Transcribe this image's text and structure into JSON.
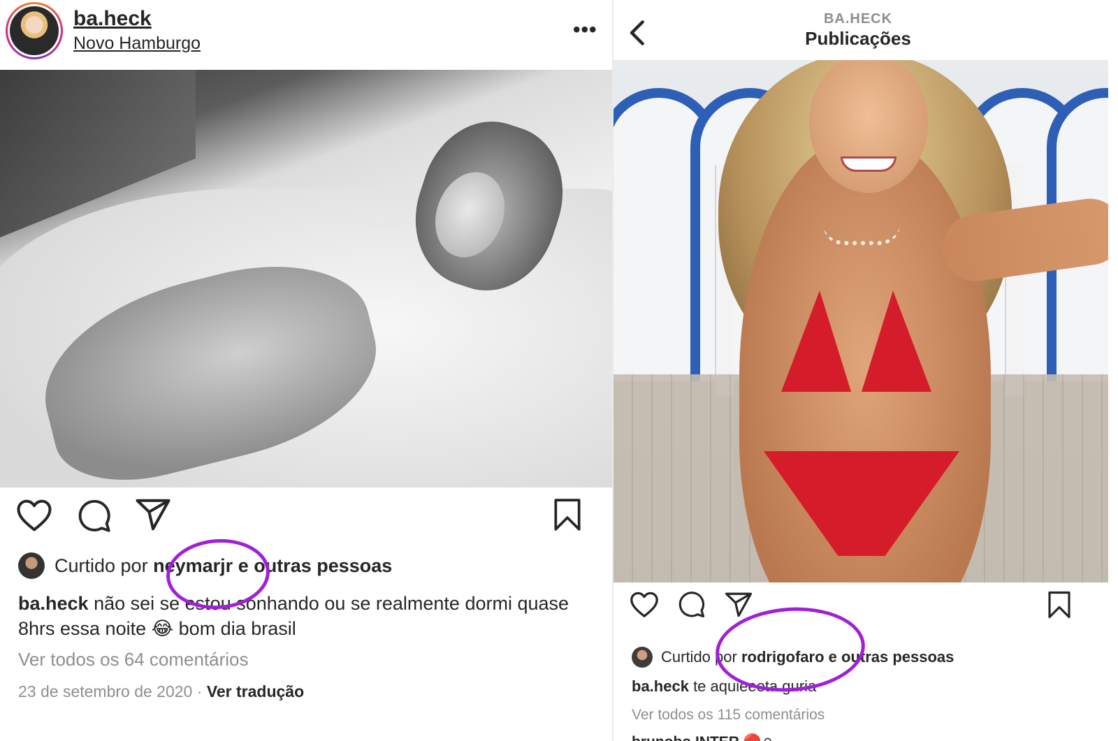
{
  "left_post": {
    "username": "ba.heck",
    "location": "Novo Hamburgo",
    "more_label": "•••",
    "liked_prefix": "Curtido por",
    "liked_user": "neymarjr",
    "liked_suffix": "e outras pessoas",
    "caption_user": "ba.heck",
    "caption_text": "não sei se estou sonhando ou se realmente dormi quase 8hrs essa noite 😂 bom dia brasil",
    "view_comments": "Ver todos os 64 comentários",
    "date": "23 de setembro de 2020",
    "separator": "·",
    "translate": "Ver tradução"
  },
  "right_post": {
    "owner": "BA.HECK",
    "title": "Publicações",
    "liked_prefix": "Curtido por",
    "liked_user": "rodrigofaro",
    "liked_suffix": "e outras pessoas",
    "caption_user": "ba.heck",
    "caption_text": "te aquieeeta guria",
    "view_comments": "Ver todos os 115 comentários",
    "next_comment": "brunobo INTER 🔴⚪"
  },
  "colors": {
    "annotation": "#a020d8",
    "muted_text": "#8e8e8e",
    "text": "#262626"
  },
  "icons": [
    "heart-icon",
    "comment-icon",
    "share-icon",
    "bookmark-icon",
    "back-chevron-icon",
    "more-icon"
  ]
}
